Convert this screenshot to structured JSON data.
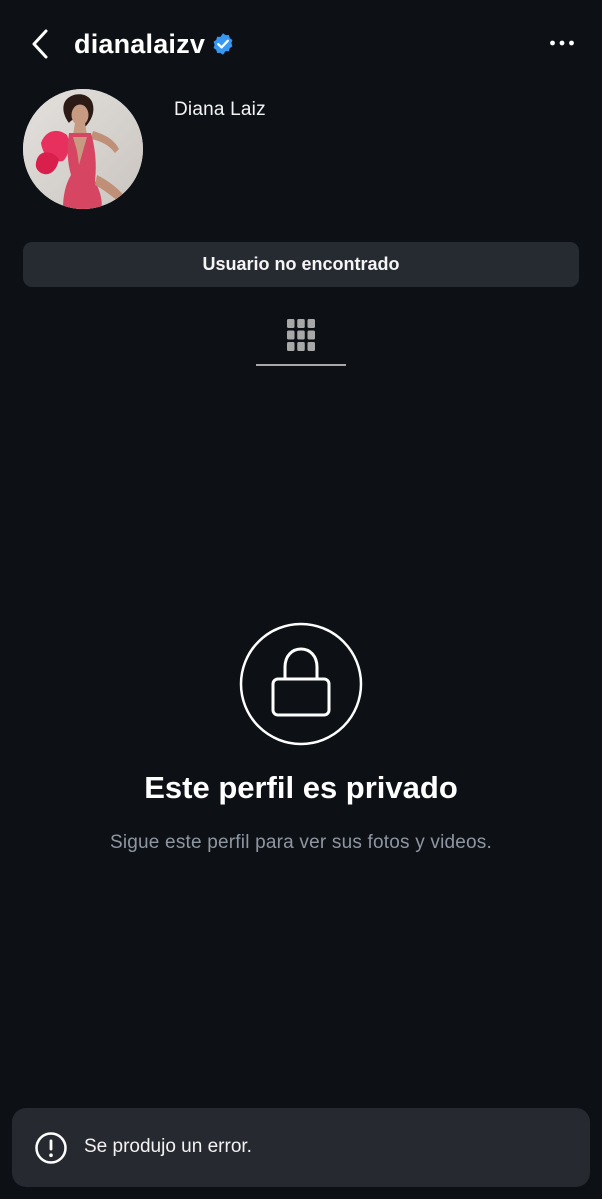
{
  "header": {
    "username": "dianalaizv",
    "verified": true,
    "back_icon": "chevron-left-icon",
    "more_icon": "more-horizontal-icon"
  },
  "profile": {
    "full_name": "Diana Laiz",
    "avatar_icon": "profile-photo"
  },
  "action_bar": {
    "label": "Usuario no encontrado"
  },
  "tabs": {
    "active": "grid",
    "grid_icon": "grid-icon"
  },
  "private": {
    "icon": "lock-icon",
    "title": "Este perfil es privado",
    "subtitle": "Sigue este perfil para ver sus fotos y videos."
  },
  "toast": {
    "icon": "alert-circle-icon",
    "message": "Se produjo un error."
  },
  "colors": {
    "background": "#0d1116",
    "verified_badge": "#3897f0",
    "button_bg": "#262a31",
    "muted_text": "#8e96a1",
    "toast_bg": "#26292f"
  }
}
